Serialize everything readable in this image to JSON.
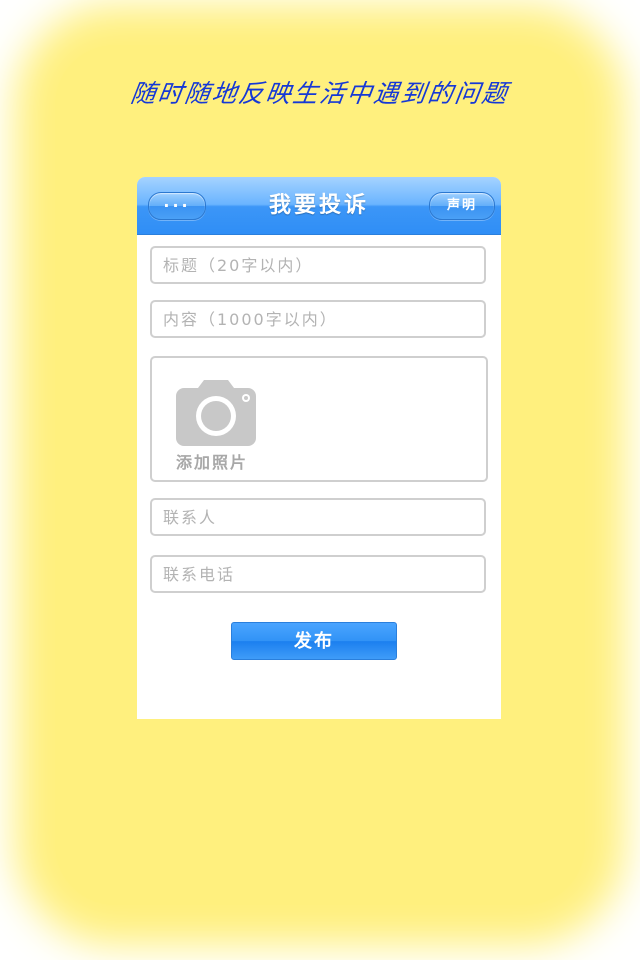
{
  "slogan": "随时随地反映生活中遇到的问题",
  "navbar": {
    "more_label": "···",
    "title": "我要投诉",
    "statement_label": "声明"
  },
  "form": {
    "title_placeholder": "标题（20字以内）",
    "content_placeholder": "内容（1000字以内）",
    "photo_label": "添加照片",
    "contact_placeholder": "联系人",
    "phone_placeholder": "联系电话",
    "submit_label": "发布"
  },
  "icons": {
    "more": "more-dots-icon",
    "camera": "camera-icon"
  },
  "colors": {
    "slogan": "#1538d6",
    "navbar": "#3c96f7",
    "background": "#fff07e",
    "submit": "#1b7fef"
  }
}
